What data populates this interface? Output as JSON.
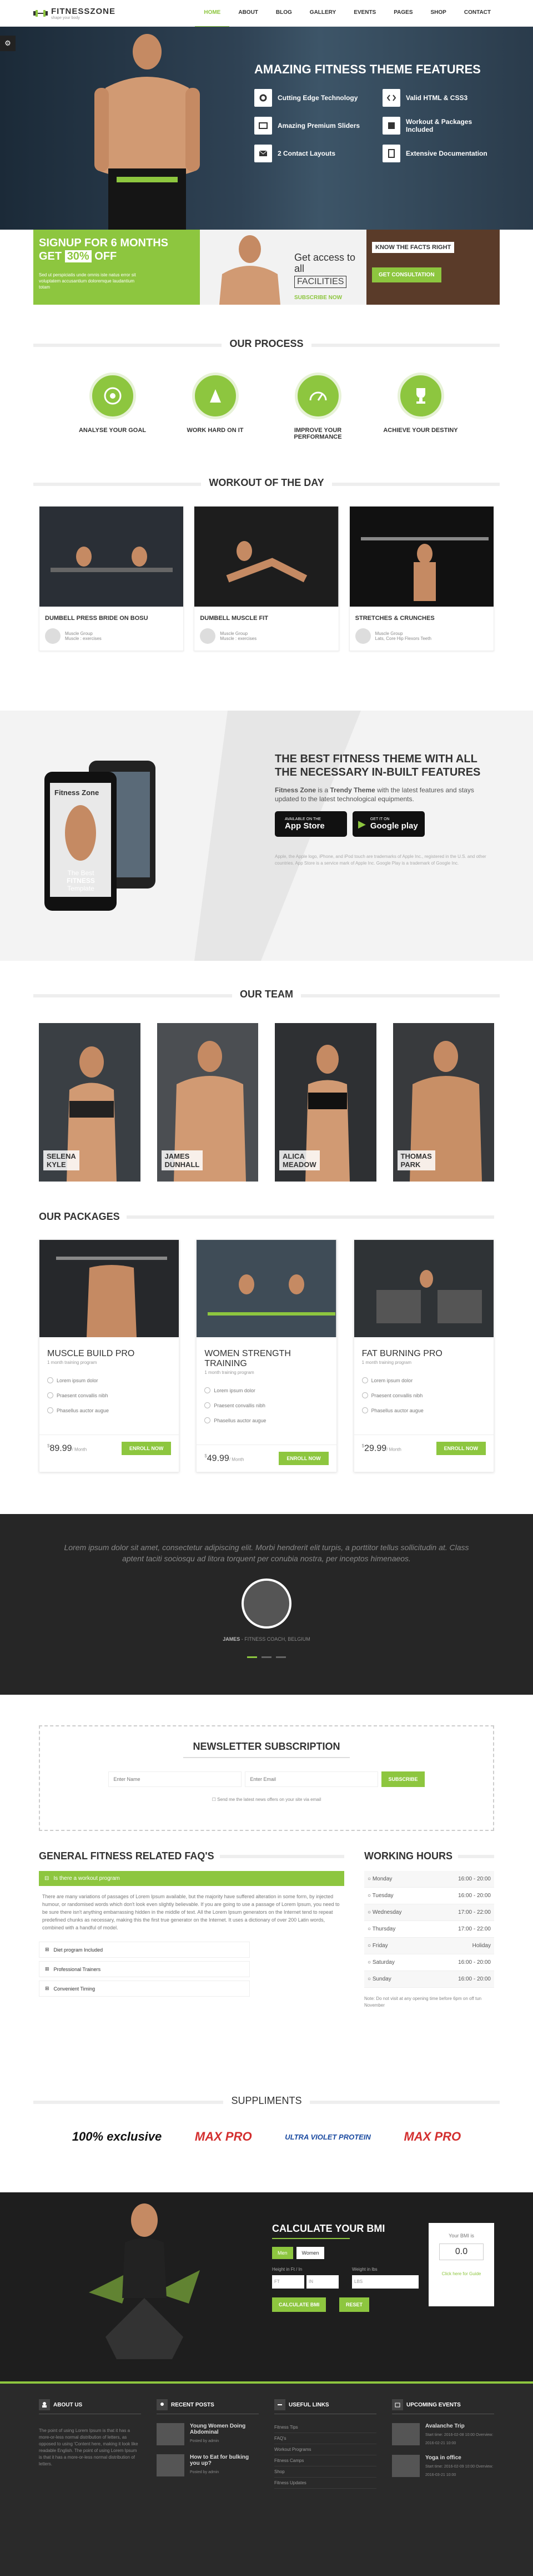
{
  "header": {
    "brand": "FITNESSZONE",
    "brand_accent": "ZONE",
    "tagline": "shape your body",
    "nav": [
      {
        "label": "HOME"
      },
      {
        "label": "ABOUT"
      },
      {
        "label": "BLOG"
      },
      {
        "label": "GALLERY"
      },
      {
        "label": "EVENTS"
      },
      {
        "label": "PAGES"
      },
      {
        "label": "SHOP"
      },
      {
        "label": "CONTACT"
      }
    ]
  },
  "hero": {
    "title": "AMAZING FITNESS THEME FEATURES",
    "features": [
      {
        "label": "Cutting Edge Technology",
        "icon": "settings-icon"
      },
      {
        "label": "Valid HTML & CSS3",
        "icon": "code-icon"
      },
      {
        "label": "Amazing Premium Sliders",
        "icon": "slider-icon"
      },
      {
        "label": "Workout & Packages Included",
        "icon": "box-icon"
      },
      {
        "label": "2 Contact Layouts",
        "icon": "mail-icon"
      },
      {
        "label": "Extensive Documentation",
        "icon": "doc-icon"
      }
    ]
  },
  "banners": {
    "a_line1": "SIGNUP FOR 6 MONTHS",
    "a_line2a": "GET",
    "a_line2b": "30%",
    "a_line2c": "OFF",
    "a_text": "Sed ut perspiciatis unde omnis iste natus error sit voluptatem accusantium doloremque laudantium totam",
    "b_line1": "Get access to all",
    "b_line2": "FACILITIES",
    "b_btn": "SUBSCRIBE NOW",
    "c_tag": "KNOW THE FACTS RIGHT",
    "c_btn": "GET CONSULTATION"
  },
  "process": {
    "title": "OUR PROCESS",
    "steps": [
      {
        "label": "ANALYSE YOUR GOAL"
      },
      {
        "label": "WORK HARD ON IT"
      },
      {
        "label": "IMPROVE YOUR PERFORMANCE"
      },
      {
        "label": "ACHIEVE YOUR DESTINY"
      }
    ]
  },
  "workout": {
    "title": "WORKOUT OF THE DAY",
    "cards": [
      {
        "title": "DUMBELL PRESS BRIDE ON BOSU",
        "group": "Muscle Group",
        "detail": "Muscle : exercises"
      },
      {
        "title": "DUMBELL MUSCLE FIT",
        "group": "Muscle Group",
        "detail": "Muscle : exercises"
      },
      {
        "title": "STRETCHES & CRUNCHES",
        "group": "Muscle Group",
        "detail": "Lats, Core Hip Flexors Teeth"
      }
    ]
  },
  "app": {
    "phone_title": "Fitness Zone",
    "phone_line1": "The Best",
    "phone_line2": "FITNESS",
    "phone_line3": "Template",
    "title": "THE BEST FITNESS THEME WITH ALL THE NECESSARY IN-BUILT FEATURES",
    "desc_brand": "Fitness Zone",
    "desc_is": "is a",
    "desc_trendy": "Trendy Theme",
    "desc_rest": "with the latest features and stays updated to the latest technological equipments.",
    "store1_small": "AVAILABLE ON THE",
    "store1": "App Store",
    "store2_small": "GET IT ON",
    "store2": "Google play",
    "note": "Apple, the Apple logo, iPhone, and iPod touch are trademarks of Apple Inc., registered in the U.S. and other countries. App Store is a service mark of Apple Inc. Google Play is a trademark of Google Inc."
  },
  "team": {
    "title": "OUR TEAM",
    "members": [
      {
        "first": "SELENA",
        "last": "KYLE"
      },
      {
        "first": "JAMES",
        "last": "DUNHALL"
      },
      {
        "first": "ALICA",
        "last": "MEADOW"
      },
      {
        "first": "THOMAS",
        "last": "PARK"
      }
    ]
  },
  "packages": {
    "title": "OUR PACKAGES",
    "items": [
      {
        "name": "MUSCLE BUILD PRO",
        "sub": "1 month training program",
        "f1": "Lorem ipsum dolor",
        "f2": "Praesent convallis nibh",
        "f3": "Phasellus auctor augue",
        "price": "89.99",
        "per": "/ Month",
        "btn": "ENROLL NOW"
      },
      {
        "name": "WOMEN STRENGTH TRAINING",
        "sub": "1 month training program",
        "f1": "Lorem ipsum dolor",
        "f2": "Praesent convallis nibh",
        "f3": "Phasellus auctor augue",
        "price": "49.99",
        "per": "/ Month",
        "btn": "ENROLL NOW"
      },
      {
        "name": "FAT BURNING PRO",
        "sub": "1 month training program",
        "f1": "Lorem ipsum dolor",
        "f2": "Praesent convallis nibh",
        "f3": "Phasellus auctor augue",
        "price": "29.99",
        "per": "/ Month",
        "btn": "ENROLL NOW"
      }
    ]
  },
  "testimonial": {
    "quote": "Lorem ipsum dolor sit amet, consectetur adipiscing elit. Morbi hendrerit elit turpis, a porttitor tellus sollicitudin at. Class aptent taciti sociosqu ad litora torquent per conubia nostra, per inceptos himenaeos.",
    "name": "JAMES",
    "role": "FITNESS COACH, BELGIUM"
  },
  "newsletter": {
    "title": "NEWSLETTER SUBSCRIPTION",
    "name_ph": "Enter Name",
    "email_ph": "Enter Email",
    "btn": "SUBSCRIBE",
    "check": "Send me the latest news offers on your site via email"
  },
  "faq": {
    "title": "GENERAL FITNESS RELATED FAQ'S",
    "open": "Is there a workout program",
    "body": "There are many variations of passages of Lorem Ipsum available, but the majority have suffered alteration in some form, by injected humour, or randomised words which don't look even slightly believable. If you are going to use a passage of Lorem Ipsum, you need to be sure there isn't anything embarrassing hidden in the middle of text. All the Lorem Ipsum generators on the Internet tend to repeat predefined chunks as necessary, making this the first true generator on the Internet. It uses a dictionary of over 200 Latin words, combined with a handful of model.",
    "items": [
      {
        "label": "Diet program Included"
      },
      {
        "label": "Professional Trainers"
      },
      {
        "label": "Convenient Timing"
      }
    ]
  },
  "hours": {
    "title": "WORKING HOURS",
    "rows": [
      {
        "day": "Monday",
        "time": "16:00 - 20:00"
      },
      {
        "day": "Tuesday",
        "time": "16:00 - 20:00"
      },
      {
        "day": "Wednesday",
        "time": "17:00 - 22:00"
      },
      {
        "day": "Thursday",
        "time": "17:00 - 22:00"
      },
      {
        "day": "Friday",
        "time": "Holiday"
      },
      {
        "day": "Saturday",
        "time": "16:00 - 20:00"
      },
      {
        "day": "Sunday",
        "time": "16:00 - 20:00"
      }
    ],
    "note": "Note: Do not visit at any opening time before 6pm on off tun November"
  },
  "supp": {
    "title": "SUPPLIMENTS",
    "brands": [
      {
        "name": "100% exclusive"
      },
      {
        "name": "MAX PRO"
      },
      {
        "name": "ULTRA VIOLET PROTEIN"
      },
      {
        "name": "MAX PRO"
      }
    ]
  },
  "bmi": {
    "title": "CALCULATE YOUR BMI",
    "unit_a": "Men",
    "unit_b": "Women",
    "height_label": "Height in Ft / In",
    "weight_label": "Weight in lbs",
    "ft": "FT",
    "in": "IN",
    "lbs": "LBS",
    "calc": "CALCULATE BMI",
    "reset": "RESET",
    "res_label": "Your BMI is",
    "res_value": "0.0",
    "res_link": "Click here for Guide"
  },
  "footer": {
    "about": "ABOUT US",
    "about_text": "The point of using Lorem Ipsum is that it has a more-or-less normal distribution of letters, as opposed to using 'Content here, making it look like readable English. The point of using Lorem Ipsum is that it has a more-or-less normal distribution of letters.",
    "recent": "RECENT POSTS",
    "posts": [
      {
        "t": "Young Women Doing Abdominal",
        "m": "Posted by admin"
      },
      {
        "t": "How to Eat for bulking you up?",
        "m": "Posted by admin"
      }
    ],
    "useful": "USEFUL LINKS",
    "links": [
      {
        "l": "Fitness Tips"
      },
      {
        "l": "FAQ's"
      },
      {
        "l": "Workout Programs"
      },
      {
        "l": "Fitness Camps"
      },
      {
        "l": "Shop"
      },
      {
        "l": "Fitness Updates"
      }
    ],
    "events": "UPCOMING EVENTS",
    "ev": [
      {
        "t": "Avalanche Trip",
        "m": "Start time: 2016-02-08 10:00 Overview: 2016-02-21 10:00"
      },
      {
        "t": "Yoga in office",
        "m": "Start time: 2016-02-09 10:00 Overview: 2016-03-21 10:00"
      }
    ]
  },
  "colors": {
    "accent": "#8dc63f",
    "dark": "#262626"
  }
}
